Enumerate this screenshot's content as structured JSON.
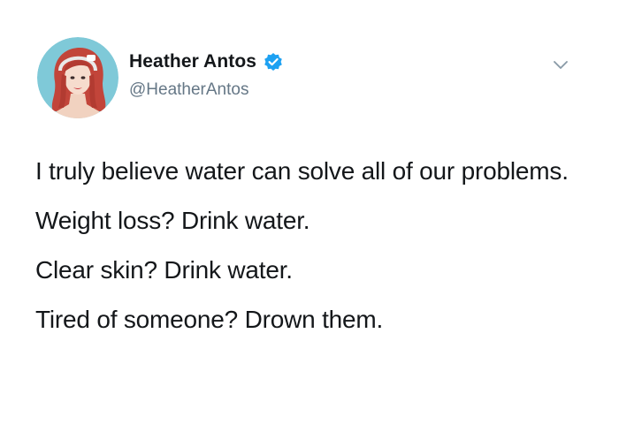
{
  "author": {
    "display_name": "Heather Antos",
    "handle": "@HeatherAntos",
    "verified": true,
    "avatar_icon": "profile-portrait",
    "verified_icon": "verified-badge-icon",
    "verified_color": "#1da1f2"
  },
  "menu": {
    "icon": "chevron-down-icon"
  },
  "tweet": {
    "paragraphs": [
      "I truly believe water can solve all of our problems.",
      "Weight loss? Drink water.",
      "Clear skin? Drink water.",
      "Tired of someone? Drown them."
    ]
  }
}
